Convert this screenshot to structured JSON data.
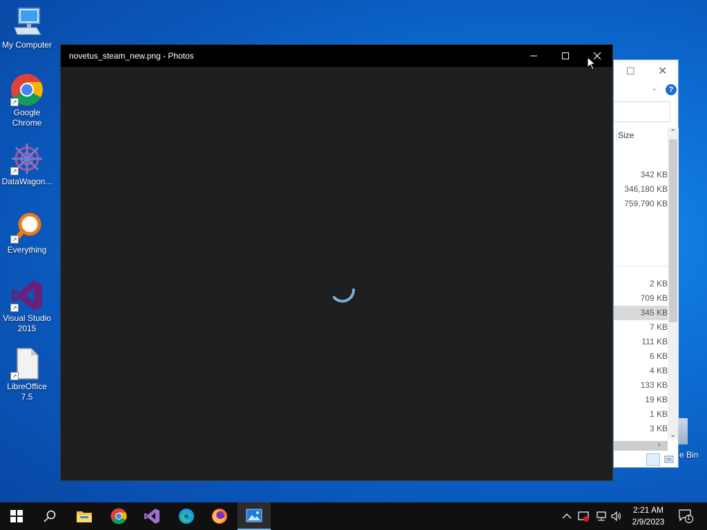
{
  "desktop": {
    "icons": [
      {
        "label": "My Computer"
      },
      {
        "label": "Google Chrome"
      },
      {
        "label": "DataWagon..."
      },
      {
        "label": "Everything"
      },
      {
        "label": "Visual Studio 2015"
      },
      {
        "label": "LibreOffice 7.5"
      }
    ],
    "recycle_bin_label": "e Bin"
  },
  "explorer": {
    "column_header": "Size",
    "sizes_top": [
      "342 KB",
      "346,180 KB",
      "759,790 KB"
    ],
    "sizes_bottom": [
      "2 KB",
      "709 KB",
      "345 KB",
      "7 KB",
      "111 KB",
      "6 KB",
      "4 KB",
      "133 KB",
      "19 KB",
      "1 KB",
      "3 KB"
    ],
    "selected_index": 2,
    "help_label": "?"
  },
  "photos": {
    "title": "novetus_steam_new.png - Photos",
    "spinner_color": "#76b0e0"
  },
  "taskbar": {
    "apps": [
      "start",
      "search",
      "file-explorer",
      "chrome",
      "visual-studio",
      "edge",
      "firefox",
      "photos"
    ],
    "active_app": "photos",
    "time": "2:21 AM",
    "date": "2/9/2023",
    "notification_count": "1"
  }
}
